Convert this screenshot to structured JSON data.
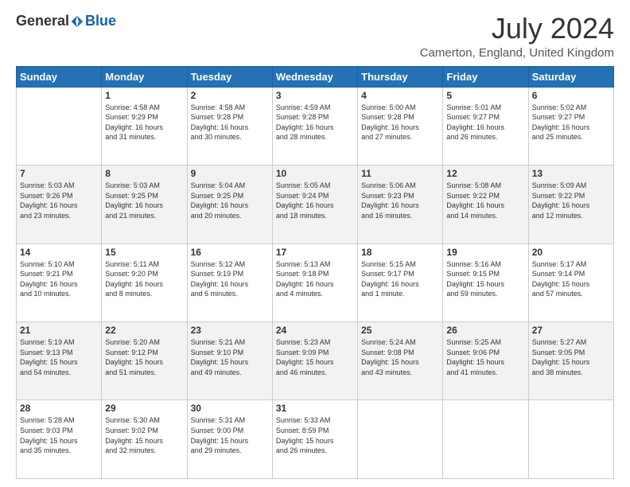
{
  "logo": {
    "general": "General",
    "blue": "Blue"
  },
  "title": "July 2024",
  "subtitle": "Camerton, England, United Kingdom",
  "weekdays": [
    "Sunday",
    "Monday",
    "Tuesday",
    "Wednesday",
    "Thursday",
    "Friday",
    "Saturday"
  ],
  "rows": [
    [
      {
        "day": "",
        "info": ""
      },
      {
        "day": "1",
        "info": "Sunrise: 4:58 AM\nSunset: 9:29 PM\nDaylight: 16 hours\nand 31 minutes."
      },
      {
        "day": "2",
        "info": "Sunrise: 4:58 AM\nSunset: 9:28 PM\nDaylight: 16 hours\nand 30 minutes."
      },
      {
        "day": "3",
        "info": "Sunrise: 4:59 AM\nSunset: 9:28 PM\nDaylight: 16 hours\nand 28 minutes."
      },
      {
        "day": "4",
        "info": "Sunrise: 5:00 AM\nSunset: 9:28 PM\nDaylight: 16 hours\nand 27 minutes."
      },
      {
        "day": "5",
        "info": "Sunrise: 5:01 AM\nSunset: 9:27 PM\nDaylight: 16 hours\nand 26 minutes."
      },
      {
        "day": "6",
        "info": "Sunrise: 5:02 AM\nSunset: 9:27 PM\nDaylight: 16 hours\nand 25 minutes."
      }
    ],
    [
      {
        "day": "7",
        "info": "Sunrise: 5:03 AM\nSunset: 9:26 PM\nDaylight: 16 hours\nand 23 minutes."
      },
      {
        "day": "8",
        "info": "Sunrise: 5:03 AM\nSunset: 9:25 PM\nDaylight: 16 hours\nand 21 minutes."
      },
      {
        "day": "9",
        "info": "Sunrise: 5:04 AM\nSunset: 9:25 PM\nDaylight: 16 hours\nand 20 minutes."
      },
      {
        "day": "10",
        "info": "Sunrise: 5:05 AM\nSunset: 9:24 PM\nDaylight: 16 hours\nand 18 minutes."
      },
      {
        "day": "11",
        "info": "Sunrise: 5:06 AM\nSunset: 9:23 PM\nDaylight: 16 hours\nand 16 minutes."
      },
      {
        "day": "12",
        "info": "Sunrise: 5:08 AM\nSunset: 9:22 PM\nDaylight: 16 hours\nand 14 minutes."
      },
      {
        "day": "13",
        "info": "Sunrise: 5:09 AM\nSunset: 9:22 PM\nDaylight: 16 hours\nand 12 minutes."
      }
    ],
    [
      {
        "day": "14",
        "info": "Sunrise: 5:10 AM\nSunset: 9:21 PM\nDaylight: 16 hours\nand 10 minutes."
      },
      {
        "day": "15",
        "info": "Sunrise: 5:11 AM\nSunset: 9:20 PM\nDaylight: 16 hours\nand 8 minutes."
      },
      {
        "day": "16",
        "info": "Sunrise: 5:12 AM\nSunset: 9:19 PM\nDaylight: 16 hours\nand 6 minutes."
      },
      {
        "day": "17",
        "info": "Sunrise: 5:13 AM\nSunset: 9:18 PM\nDaylight: 16 hours\nand 4 minutes."
      },
      {
        "day": "18",
        "info": "Sunrise: 5:15 AM\nSunset: 9:17 PM\nDaylight: 16 hours\nand 1 minute."
      },
      {
        "day": "19",
        "info": "Sunrise: 5:16 AM\nSunset: 9:15 PM\nDaylight: 15 hours\nand 59 minutes."
      },
      {
        "day": "20",
        "info": "Sunrise: 5:17 AM\nSunset: 9:14 PM\nDaylight: 15 hours\nand 57 minutes."
      }
    ],
    [
      {
        "day": "21",
        "info": "Sunrise: 5:19 AM\nSunset: 9:13 PM\nDaylight: 15 hours\nand 54 minutes."
      },
      {
        "day": "22",
        "info": "Sunrise: 5:20 AM\nSunset: 9:12 PM\nDaylight: 15 hours\nand 51 minutes."
      },
      {
        "day": "23",
        "info": "Sunrise: 5:21 AM\nSunset: 9:10 PM\nDaylight: 15 hours\nand 49 minutes."
      },
      {
        "day": "24",
        "info": "Sunrise: 5:23 AM\nSunset: 9:09 PM\nDaylight: 15 hours\nand 46 minutes."
      },
      {
        "day": "25",
        "info": "Sunrise: 5:24 AM\nSunset: 9:08 PM\nDaylight: 15 hours\nand 43 minutes."
      },
      {
        "day": "26",
        "info": "Sunrise: 5:25 AM\nSunset: 9:06 PM\nDaylight: 15 hours\nand 41 minutes."
      },
      {
        "day": "27",
        "info": "Sunrise: 5:27 AM\nSunset: 9:05 PM\nDaylight: 15 hours\nand 38 minutes."
      }
    ],
    [
      {
        "day": "28",
        "info": "Sunrise: 5:28 AM\nSunset: 9:03 PM\nDaylight: 15 hours\nand 35 minutes."
      },
      {
        "day": "29",
        "info": "Sunrise: 5:30 AM\nSunset: 9:02 PM\nDaylight: 15 hours\nand 32 minutes."
      },
      {
        "day": "30",
        "info": "Sunrise: 5:31 AM\nSunset: 9:00 PM\nDaylight: 15 hours\nand 29 minutes."
      },
      {
        "day": "31",
        "info": "Sunrise: 5:33 AM\nSunset: 8:59 PM\nDaylight: 15 hours\nand 26 minutes."
      },
      {
        "day": "",
        "info": ""
      },
      {
        "day": "",
        "info": ""
      },
      {
        "day": "",
        "info": ""
      }
    ]
  ]
}
